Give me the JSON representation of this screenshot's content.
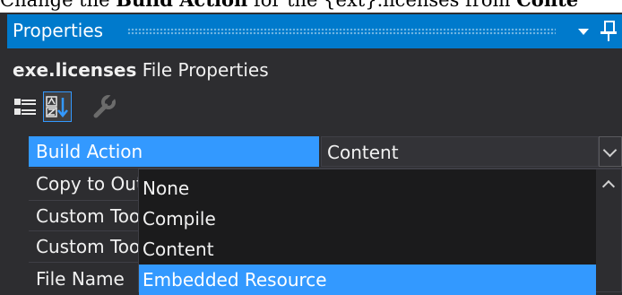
{
  "caption": {
    "prefix": "Change the ",
    "bold": "Build Action",
    "middle": " for the {ext}.licenses from ",
    "bold2": "Conte"
  },
  "window": {
    "title": "Properties"
  },
  "object": {
    "name": "exe.licenses",
    "type": "File Properties"
  },
  "toolbar": {
    "buttons": [
      {
        "icon": "categorized-icon"
      },
      {
        "icon": "alphabetical-icon",
        "active": true
      },
      {
        "icon": "property-pages-icon"
      }
    ]
  },
  "properties": [
    {
      "name": "Build Action",
      "value": "Content",
      "selected": true
    },
    {
      "name": "Copy to Output Directory",
      "value": ""
    },
    {
      "name": "Custom Tool",
      "value": ""
    },
    {
      "name": "Custom Tool Namespace",
      "value": ""
    },
    {
      "name": "File Name",
      "value": ""
    }
  ],
  "dropdown": {
    "options": [
      "None",
      "Compile",
      "Content",
      "Embedded Resource"
    ],
    "highlighted": "Embedded Resource"
  },
  "colors": {
    "accent": "#007acc",
    "selection": "#3399ff",
    "background": "#2d2d30"
  }
}
